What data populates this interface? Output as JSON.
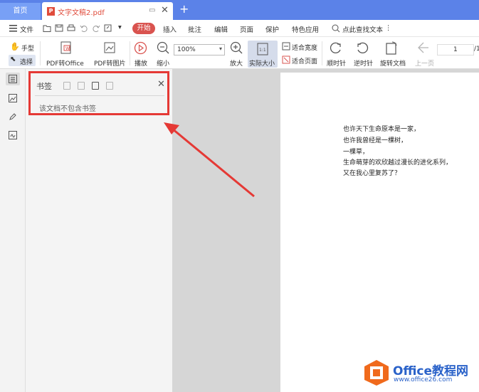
{
  "tabs": {
    "home": "首页",
    "doc_title": "文字文稿2.pdf",
    "doc_badge": "P",
    "close_glyph": "✕",
    "add_glyph": "+"
  },
  "menu": {
    "file": "文件",
    "start": "开始",
    "insert": "插入",
    "annotate": "批注",
    "edit": "编辑",
    "page": "页面",
    "protect": "保护",
    "features": "特色应用",
    "search": "点此查找文本"
  },
  "toolbar": {
    "hand": "手型",
    "select": "选择",
    "pdf_to_office": "PDF转Office",
    "pdf_to_image": "PDF转图片",
    "play": "播放",
    "zoom_out": "缩小",
    "zoom_value": "100%",
    "zoom_in": "放大",
    "actual_size": "实际大小",
    "fit_width": "适合宽度",
    "fit_page": "适合页面",
    "rotate_cw": "顺时针",
    "rotate_ccw": "逆时针",
    "rotate_doc": "旋转文档",
    "prev_page": "上一页",
    "page_number": "1",
    "page_total": "/1"
  },
  "bookmarks": {
    "title": "书签",
    "empty_message": "该文档不包含书签"
  },
  "document": {
    "lines": [
      "也许天下生命原本是一家，",
      "也许我曾经是一棵树，",
      "一棵草，",
      "生命萌芽的欢欣越过漫长的进化系列，",
      "又在我心里复苏了？"
    ]
  },
  "watermark": {
    "brand": "Office教程网",
    "url": "www.office26.com"
  },
  "colors": {
    "tabbar": "#5b82e8",
    "accent_red": "#e53935",
    "start_button": "#d9534f",
    "logo_blue": "#2a62c9",
    "logo_orange": "#f06a1c"
  }
}
